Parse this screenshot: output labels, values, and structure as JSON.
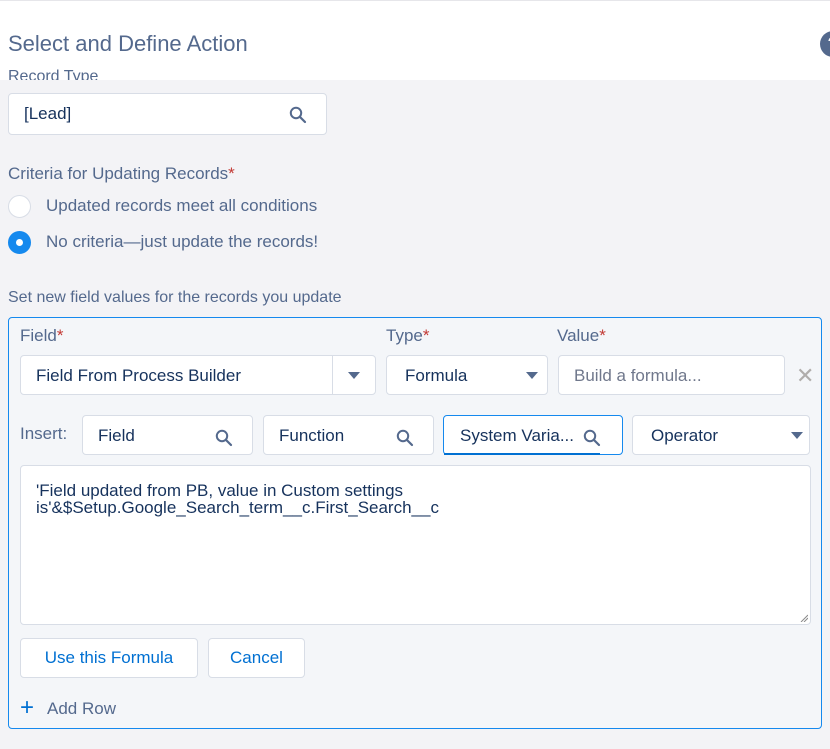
{
  "header": {
    "title": "Select and Define Action",
    "help_glyph": "?"
  },
  "record_type": {
    "label_fragment": "Record Type",
    "value": "[Lead]"
  },
  "criteria": {
    "label": "Criteria for Updating Records",
    "required_mark": "*",
    "options": [
      {
        "label": "Updated records meet all conditions",
        "selected": false
      },
      {
        "label": "No criteria—just update the records!",
        "selected": true
      }
    ]
  },
  "field_values": {
    "label": "Set new field values for the records you update",
    "columns": {
      "field": "Field",
      "type": "Type",
      "value": "Value",
      "required_mark": "*"
    },
    "row": {
      "field": "Field From Process Builder",
      "type": "Formula",
      "value_placeholder": "Build a formula..."
    }
  },
  "insert": {
    "label": "Insert:",
    "field": "Field",
    "function": "Function",
    "system_variables": "System Varia...",
    "operator": "Operator"
  },
  "formula": {
    "text": "'Field updated from PB, value in Custom settings\nis'&$Setup.Google_Search_term__c.First_Search__c"
  },
  "buttons": {
    "use_formula": "Use this Formula",
    "cancel": "Cancel"
  },
  "add_row": {
    "label": "Add Row"
  },
  "colors": {
    "accent": "#1589ee",
    "link": "#0070d2",
    "required": "#c23934"
  }
}
